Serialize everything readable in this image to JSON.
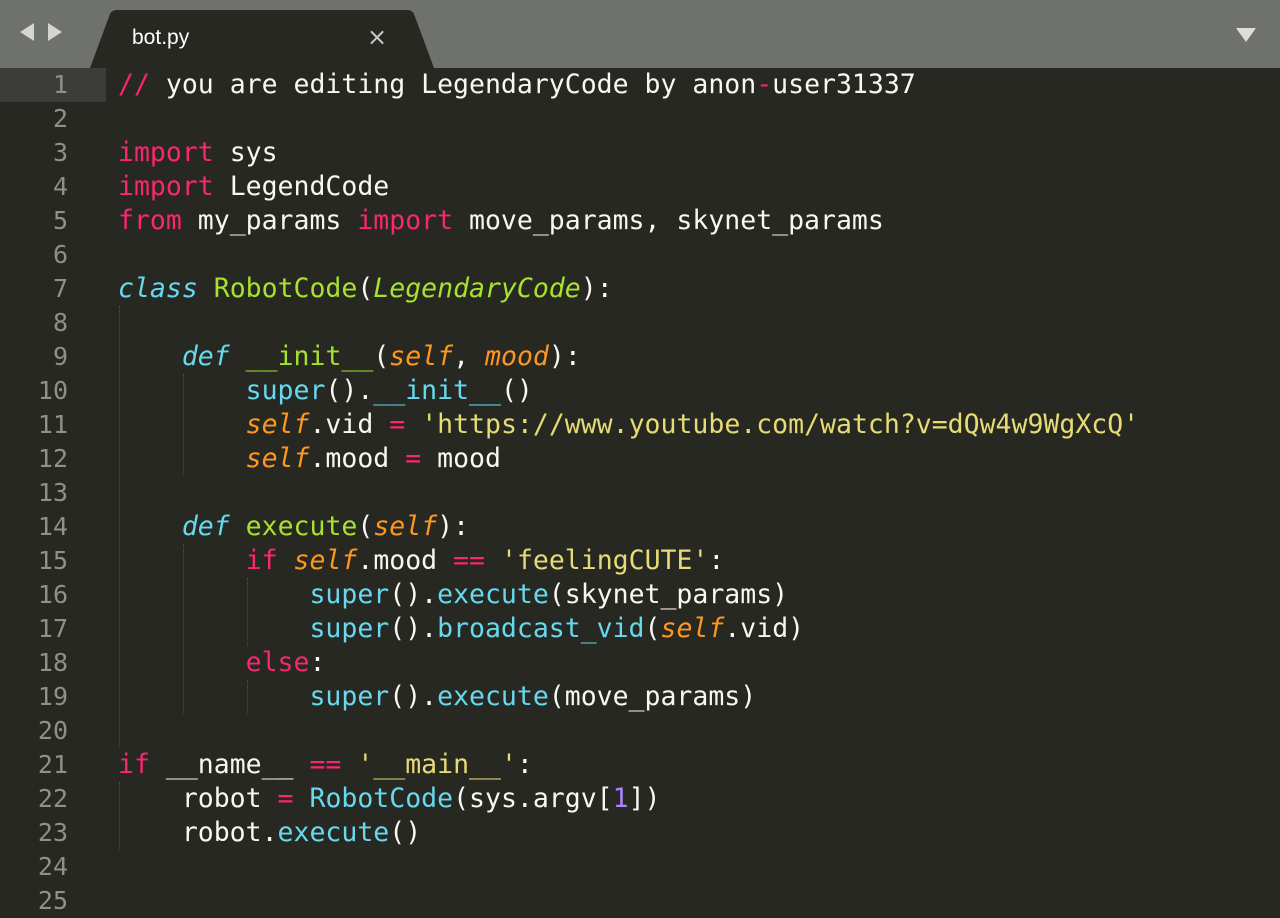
{
  "tab": {
    "filename": "bot.py"
  },
  "icons": {
    "nav_back": "triangle-left-icon",
    "nav_forward": "triangle-right-icon",
    "tab_close": "close-icon",
    "tab_menu": "triangle-down-icon"
  },
  "colors": {
    "background": "#272822",
    "keyword": "#f92672",
    "storage": "#66d9ef",
    "class_name": "#a6e22e",
    "parameter": "#fd971f",
    "string": "#e6db74",
    "number": "#ae81ff",
    "text": "#f8f8f2",
    "line_number": "#8f908a"
  },
  "editor": {
    "current_line": 1,
    "lines": [
      {
        "n": "1",
        "tokens": [
          [
            "op",
            "//"
          ],
          [
            "cm",
            " you are editing LegendaryCode by anon"
          ],
          [
            "op",
            "-"
          ],
          [
            "cm",
            "user31337"
          ]
        ]
      },
      {
        "n": "2",
        "tokens": []
      },
      {
        "n": "3",
        "tokens": [
          [
            "kw",
            "import"
          ],
          [
            "cm",
            " sys"
          ]
        ]
      },
      {
        "n": "4",
        "tokens": [
          [
            "kw",
            "import"
          ],
          [
            "cm",
            " LegendCode"
          ]
        ]
      },
      {
        "n": "5",
        "tokens": [
          [
            "kw",
            "from"
          ],
          [
            "cm",
            " my_params "
          ],
          [
            "kw",
            "import"
          ],
          [
            "cm",
            " move_params, skynet_params"
          ]
        ]
      },
      {
        "n": "6",
        "tokens": []
      },
      {
        "n": "7",
        "tokens": [
          [
            "storage",
            "class"
          ],
          [
            "cm",
            " "
          ],
          [
            "cls",
            "RobotCode"
          ],
          [
            "cm",
            "("
          ],
          [
            "inherit",
            "LegendaryCode"
          ],
          [
            "cm",
            "):"
          ]
        ]
      },
      {
        "n": "8",
        "tokens": []
      },
      {
        "n": "9",
        "tokens": [
          [
            "cm",
            "    "
          ],
          [
            "storage",
            "def"
          ],
          [
            "cm",
            " "
          ],
          [
            "fn",
            "__init__"
          ],
          [
            "cm",
            "("
          ],
          [
            "param",
            "self"
          ],
          [
            "cm",
            ", "
          ],
          [
            "param",
            "mood"
          ],
          [
            "cm",
            "):"
          ]
        ]
      },
      {
        "n": "10",
        "tokens": [
          [
            "cm",
            "        "
          ],
          [
            "sup",
            "super"
          ],
          [
            "cm",
            "()."
          ],
          [
            "sup",
            "__init__"
          ],
          [
            "cm",
            "()"
          ]
        ]
      },
      {
        "n": "11",
        "tokens": [
          [
            "cm",
            "        "
          ],
          [
            "param",
            "self"
          ],
          [
            "cm",
            ".vid "
          ],
          [
            "op",
            "="
          ],
          [
            "cm",
            " "
          ],
          [
            "str",
            "'https://www.youtube.com/watch?v=dQw4w9WgXcQ'"
          ]
        ]
      },
      {
        "n": "12",
        "tokens": [
          [
            "cm",
            "        "
          ],
          [
            "param",
            "self"
          ],
          [
            "cm",
            ".mood "
          ],
          [
            "op",
            "="
          ],
          [
            "cm",
            " mood"
          ]
        ]
      },
      {
        "n": "13",
        "tokens": []
      },
      {
        "n": "14",
        "tokens": [
          [
            "cm",
            "    "
          ],
          [
            "storage",
            "def"
          ],
          [
            "cm",
            " "
          ],
          [
            "fn",
            "execute"
          ],
          [
            "cm",
            "("
          ],
          [
            "param",
            "self"
          ],
          [
            "cm",
            "):"
          ]
        ]
      },
      {
        "n": "15",
        "tokens": [
          [
            "cm",
            "        "
          ],
          [
            "kw",
            "if"
          ],
          [
            "cm",
            " "
          ],
          [
            "param",
            "self"
          ],
          [
            "cm",
            ".mood "
          ],
          [
            "op",
            "=="
          ],
          [
            "cm",
            " "
          ],
          [
            "str",
            "'feelingCUTE'"
          ],
          [
            "cm",
            ":"
          ]
        ]
      },
      {
        "n": "16",
        "tokens": [
          [
            "cm",
            "            "
          ],
          [
            "sup",
            "super"
          ],
          [
            "cm",
            "()."
          ],
          [
            "sup",
            "execute"
          ],
          [
            "cm",
            "(skynet_params)"
          ]
        ]
      },
      {
        "n": "17",
        "tokens": [
          [
            "cm",
            "            "
          ],
          [
            "sup",
            "super"
          ],
          [
            "cm",
            "()."
          ],
          [
            "sup",
            "broadcast_vid"
          ],
          [
            "cm",
            "("
          ],
          [
            "param",
            "self"
          ],
          [
            "cm",
            ".vid)"
          ]
        ]
      },
      {
        "n": "18",
        "tokens": [
          [
            "cm",
            "        "
          ],
          [
            "kw",
            "else"
          ],
          [
            "cm",
            ":"
          ]
        ]
      },
      {
        "n": "19",
        "tokens": [
          [
            "cm",
            "            "
          ],
          [
            "sup",
            "super"
          ],
          [
            "cm",
            "()."
          ],
          [
            "sup",
            "execute"
          ],
          [
            "cm",
            "(move_params)"
          ]
        ]
      },
      {
        "n": "20",
        "tokens": []
      },
      {
        "n": "21",
        "tokens": [
          [
            "kw",
            "if"
          ],
          [
            "cm",
            " __name__ "
          ],
          [
            "op",
            "=="
          ],
          [
            "cm",
            " "
          ],
          [
            "str",
            "'__main__'"
          ],
          [
            "cm",
            ":"
          ]
        ]
      },
      {
        "n": "22",
        "tokens": [
          [
            "cm",
            "    robot "
          ],
          [
            "op",
            "="
          ],
          [
            "cm",
            " "
          ],
          [
            "sup",
            "RobotCode"
          ],
          [
            "cm",
            "(sys.argv["
          ],
          [
            "num",
            "1"
          ],
          [
            "cm",
            "])"
          ]
        ]
      },
      {
        "n": "23",
        "tokens": [
          [
            "cm",
            "    robot."
          ],
          [
            "sup",
            "execute"
          ],
          [
            "cm",
            "()"
          ]
        ]
      },
      {
        "n": "24",
        "tokens": []
      },
      {
        "n": "25",
        "tokens": []
      }
    ]
  }
}
